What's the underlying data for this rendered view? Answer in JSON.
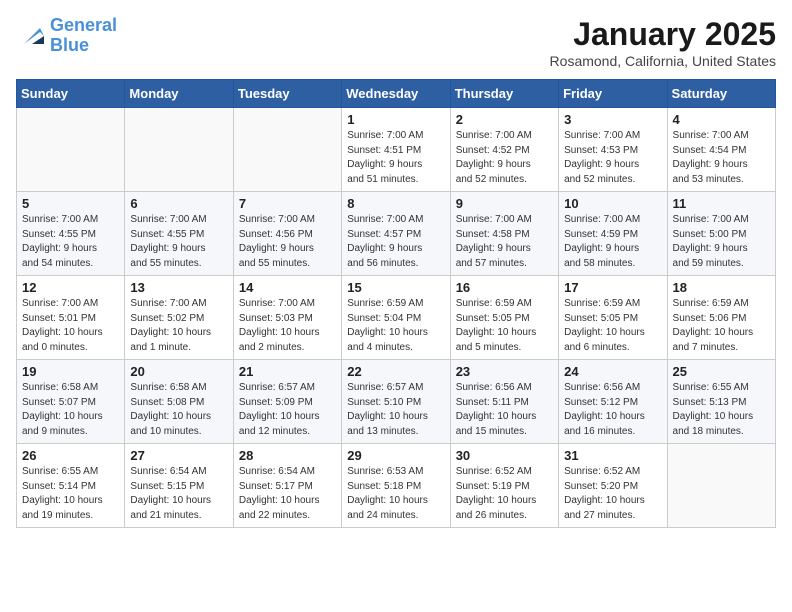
{
  "header": {
    "logo_line1": "General",
    "logo_line2": "Blue",
    "month": "January 2025",
    "location": "Rosamond, California, United States"
  },
  "weekdays": [
    "Sunday",
    "Monday",
    "Tuesday",
    "Wednesday",
    "Thursday",
    "Friday",
    "Saturday"
  ],
  "weeks": [
    [
      {
        "day": "",
        "info": ""
      },
      {
        "day": "",
        "info": ""
      },
      {
        "day": "",
        "info": ""
      },
      {
        "day": "1",
        "info": "Sunrise: 7:00 AM\nSunset: 4:51 PM\nDaylight: 9 hours\nand 51 minutes."
      },
      {
        "day": "2",
        "info": "Sunrise: 7:00 AM\nSunset: 4:52 PM\nDaylight: 9 hours\nand 52 minutes."
      },
      {
        "day": "3",
        "info": "Sunrise: 7:00 AM\nSunset: 4:53 PM\nDaylight: 9 hours\nand 52 minutes."
      },
      {
        "day": "4",
        "info": "Sunrise: 7:00 AM\nSunset: 4:54 PM\nDaylight: 9 hours\nand 53 minutes."
      }
    ],
    [
      {
        "day": "5",
        "info": "Sunrise: 7:00 AM\nSunset: 4:55 PM\nDaylight: 9 hours\nand 54 minutes."
      },
      {
        "day": "6",
        "info": "Sunrise: 7:00 AM\nSunset: 4:55 PM\nDaylight: 9 hours\nand 55 minutes."
      },
      {
        "day": "7",
        "info": "Sunrise: 7:00 AM\nSunset: 4:56 PM\nDaylight: 9 hours\nand 55 minutes."
      },
      {
        "day": "8",
        "info": "Sunrise: 7:00 AM\nSunset: 4:57 PM\nDaylight: 9 hours\nand 56 minutes."
      },
      {
        "day": "9",
        "info": "Sunrise: 7:00 AM\nSunset: 4:58 PM\nDaylight: 9 hours\nand 57 minutes."
      },
      {
        "day": "10",
        "info": "Sunrise: 7:00 AM\nSunset: 4:59 PM\nDaylight: 9 hours\nand 58 minutes."
      },
      {
        "day": "11",
        "info": "Sunrise: 7:00 AM\nSunset: 5:00 PM\nDaylight: 9 hours\nand 59 minutes."
      }
    ],
    [
      {
        "day": "12",
        "info": "Sunrise: 7:00 AM\nSunset: 5:01 PM\nDaylight: 10 hours\nand 0 minutes."
      },
      {
        "day": "13",
        "info": "Sunrise: 7:00 AM\nSunset: 5:02 PM\nDaylight: 10 hours\nand 1 minute."
      },
      {
        "day": "14",
        "info": "Sunrise: 7:00 AM\nSunset: 5:03 PM\nDaylight: 10 hours\nand 2 minutes."
      },
      {
        "day": "15",
        "info": "Sunrise: 6:59 AM\nSunset: 5:04 PM\nDaylight: 10 hours\nand 4 minutes."
      },
      {
        "day": "16",
        "info": "Sunrise: 6:59 AM\nSunset: 5:05 PM\nDaylight: 10 hours\nand 5 minutes."
      },
      {
        "day": "17",
        "info": "Sunrise: 6:59 AM\nSunset: 5:05 PM\nDaylight: 10 hours\nand 6 minutes."
      },
      {
        "day": "18",
        "info": "Sunrise: 6:59 AM\nSunset: 5:06 PM\nDaylight: 10 hours\nand 7 minutes."
      }
    ],
    [
      {
        "day": "19",
        "info": "Sunrise: 6:58 AM\nSunset: 5:07 PM\nDaylight: 10 hours\nand 9 minutes."
      },
      {
        "day": "20",
        "info": "Sunrise: 6:58 AM\nSunset: 5:08 PM\nDaylight: 10 hours\nand 10 minutes."
      },
      {
        "day": "21",
        "info": "Sunrise: 6:57 AM\nSunset: 5:09 PM\nDaylight: 10 hours\nand 12 minutes."
      },
      {
        "day": "22",
        "info": "Sunrise: 6:57 AM\nSunset: 5:10 PM\nDaylight: 10 hours\nand 13 minutes."
      },
      {
        "day": "23",
        "info": "Sunrise: 6:56 AM\nSunset: 5:11 PM\nDaylight: 10 hours\nand 15 minutes."
      },
      {
        "day": "24",
        "info": "Sunrise: 6:56 AM\nSunset: 5:12 PM\nDaylight: 10 hours\nand 16 minutes."
      },
      {
        "day": "25",
        "info": "Sunrise: 6:55 AM\nSunset: 5:13 PM\nDaylight: 10 hours\nand 18 minutes."
      }
    ],
    [
      {
        "day": "26",
        "info": "Sunrise: 6:55 AM\nSunset: 5:14 PM\nDaylight: 10 hours\nand 19 minutes."
      },
      {
        "day": "27",
        "info": "Sunrise: 6:54 AM\nSunset: 5:15 PM\nDaylight: 10 hours\nand 21 minutes."
      },
      {
        "day": "28",
        "info": "Sunrise: 6:54 AM\nSunset: 5:17 PM\nDaylight: 10 hours\nand 22 minutes."
      },
      {
        "day": "29",
        "info": "Sunrise: 6:53 AM\nSunset: 5:18 PM\nDaylight: 10 hours\nand 24 minutes."
      },
      {
        "day": "30",
        "info": "Sunrise: 6:52 AM\nSunset: 5:19 PM\nDaylight: 10 hours\nand 26 minutes."
      },
      {
        "day": "31",
        "info": "Sunrise: 6:52 AM\nSunset: 5:20 PM\nDaylight: 10 hours\nand 27 minutes."
      },
      {
        "day": "",
        "info": ""
      }
    ]
  ]
}
